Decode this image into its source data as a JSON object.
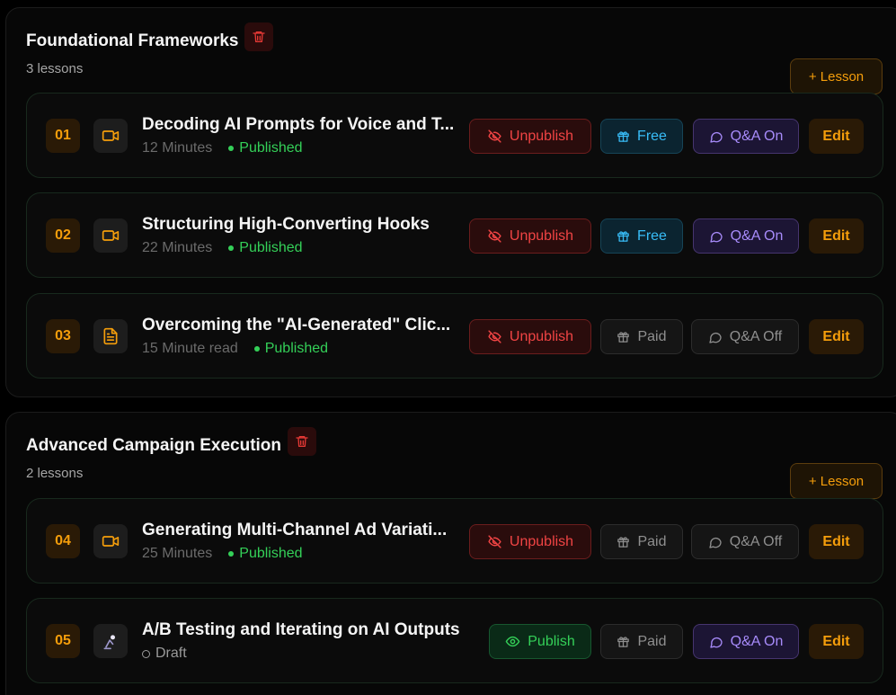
{
  "colors": {
    "accent": "#f59e0b",
    "published": "#34d058",
    "unpublish": "#f04444",
    "free": "#38bdf8",
    "qa_on": "#a78bfa",
    "muted": "#8f8f8f"
  },
  "sections": [
    {
      "title": "Foundational Frameworks",
      "count": "3 lessons",
      "add_label": "+ Lesson",
      "lessons": [
        {
          "num": "01",
          "icon": "video-icon",
          "title": "Decoding AI Prompts for Voice and T...",
          "duration": "12 Minutes",
          "status": "Published",
          "publish_label": "Unpublish",
          "access_label": "Free",
          "qa_label": "Q&A On",
          "edit_label": "Edit"
        },
        {
          "num": "02",
          "icon": "video-icon",
          "title": "Structuring High-Converting Hooks",
          "duration": "22 Minutes",
          "status": "Published",
          "publish_label": "Unpublish",
          "access_label": "Free",
          "qa_label": "Q&A On",
          "edit_label": "Edit"
        },
        {
          "num": "03",
          "icon": "document-icon",
          "title": "Overcoming the \"AI-Generated\" Clic...",
          "duration": "15 Minute read",
          "status": "Published",
          "publish_label": "Unpublish",
          "access_label": "Paid",
          "qa_label": "Q&A Off",
          "edit_label": "Edit"
        }
      ]
    },
    {
      "title": "Advanced Campaign Execution",
      "count": "2 lessons",
      "add_label": "+ Lesson",
      "lessons": [
        {
          "num": "04",
          "icon": "video-icon",
          "title": "Generating Multi-Channel Ad Variati...",
          "duration": "25 Minutes",
          "status": "Published",
          "publish_label": "Unpublish",
          "access_label": "Paid",
          "qa_label": "Q&A Off",
          "edit_label": "Edit"
        },
        {
          "num": "05",
          "icon": "broken-image-icon",
          "title": "A/B Testing and Iterating on AI Outputs",
          "duration": "",
          "status": "Draft",
          "publish_label": "Publish",
          "access_label": "Paid",
          "qa_label": "Q&A On",
          "edit_label": "Edit"
        }
      ]
    }
  ]
}
